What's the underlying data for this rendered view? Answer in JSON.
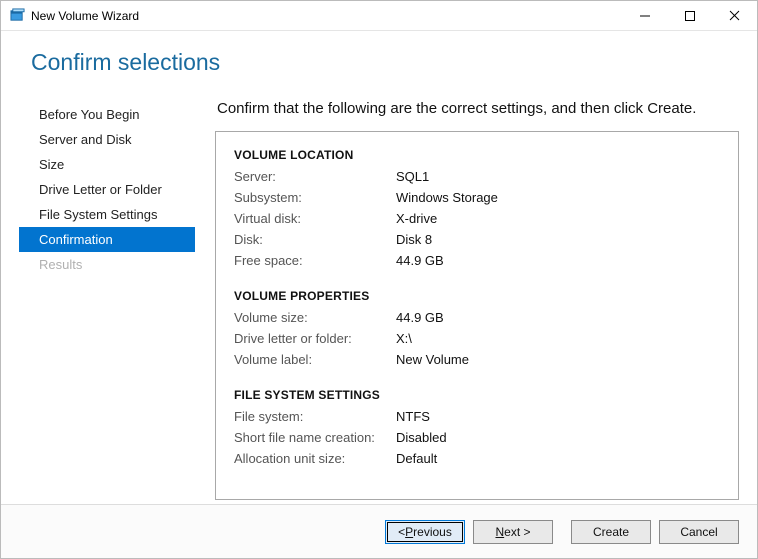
{
  "window": {
    "title": "New Volume Wizard"
  },
  "header": {
    "title": "Confirm selections"
  },
  "sidebar": {
    "steps": [
      {
        "label": "Before You Begin"
      },
      {
        "label": "Server and Disk"
      },
      {
        "label": "Size"
      },
      {
        "label": "Drive Letter or Folder"
      },
      {
        "label": "File System Settings"
      },
      {
        "label": "Confirmation"
      },
      {
        "label": "Results"
      }
    ]
  },
  "instruction": "Confirm that the following are the correct settings, and then click Create.",
  "sections": {
    "location": {
      "title": "VOLUME LOCATION",
      "server_k": "Server:",
      "server_v": "SQL1",
      "subsystem_k": "Subsystem:",
      "subsystem_v": "Windows Storage",
      "vdisk_k": "Virtual disk:",
      "vdisk_v": "X-drive",
      "disk_k": "Disk:",
      "disk_v": "Disk 8",
      "free_k": "Free space:",
      "free_v": "44.9 GB"
    },
    "properties": {
      "title": "VOLUME PROPERTIES",
      "size_k": "Volume size:",
      "size_v": "44.9 GB",
      "drive_k": "Drive letter or folder:",
      "drive_v": "X:\\",
      "label_k": "Volume label:",
      "label_v": "New Volume"
    },
    "fs": {
      "title": "FILE SYSTEM SETTINGS",
      "fs_k": "File system:",
      "fs_v": "NTFS",
      "short_k": "Short file name creation:",
      "short_v": "Disabled",
      "alloc_k": "Allocation unit size:",
      "alloc_v": "Default"
    }
  },
  "buttons": {
    "previous_pre": "< ",
    "previous_u": "P",
    "previous_post": "revious",
    "next_u": "N",
    "next_post": "ext >",
    "create": "Create",
    "cancel": "Cancel"
  }
}
